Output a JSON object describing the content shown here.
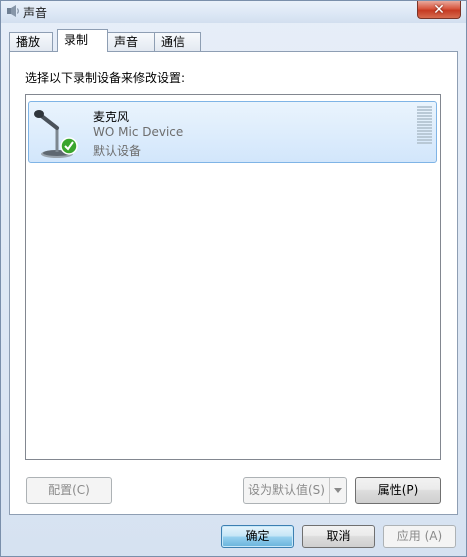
{
  "window": {
    "title": "声音",
    "close_label": "✕"
  },
  "tabs": [
    {
      "label": "播放"
    },
    {
      "label": "录制"
    },
    {
      "label": "声音"
    },
    {
      "label": "通信"
    }
  ],
  "recording": {
    "instruction": "选择以下录制设备来修改设置:",
    "devices": [
      {
        "name": "麦克风",
        "description": "WO Mic Device",
        "status": "默认设备",
        "icon": "microphone-icon",
        "badge_icon": "checkmark-icon",
        "input_level": 0
      }
    ]
  },
  "panel_buttons": {
    "configure": "配置(C)",
    "set_default": "设为默认值(S)",
    "properties": "属性(P)"
  },
  "dialog_buttons": {
    "ok": "确定",
    "cancel": "取消",
    "apply": "应用 (A)"
  },
  "colors": {
    "selection_border": "#7fb4e6",
    "selection_fill": "#d2e6fb",
    "close_red": "#c63a22",
    "check_green": "#3aa52d"
  }
}
